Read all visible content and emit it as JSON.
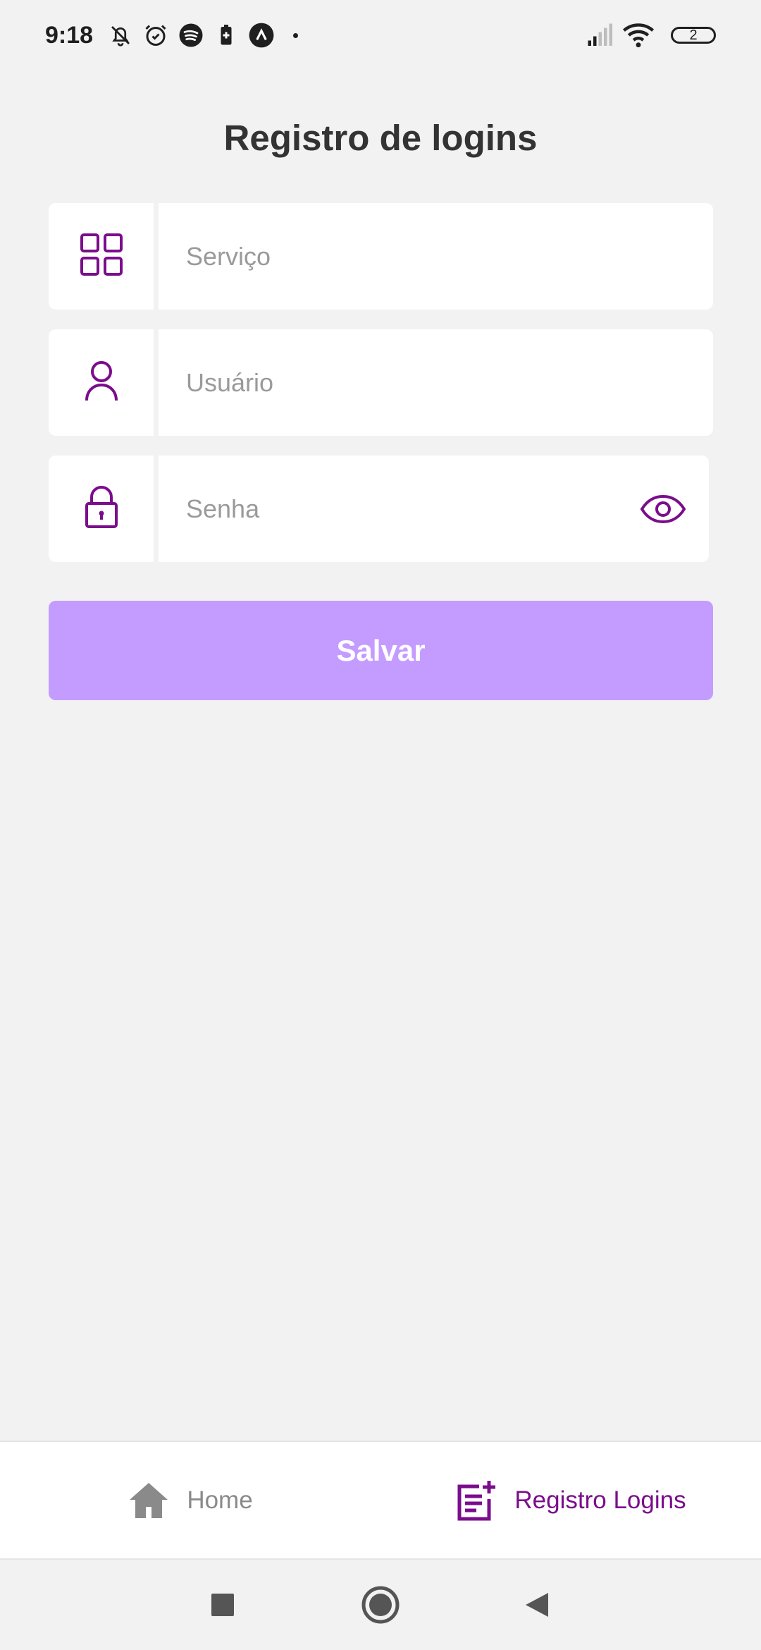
{
  "status_bar": {
    "time": "9:18",
    "battery_level": "2",
    "icons": [
      "muted-bell-icon",
      "alarm-icon",
      "spotify-icon",
      "battery-saver-icon",
      "app-notification-icon",
      "notification-dot",
      "signal-icon",
      "wifi-icon",
      "battery-icon"
    ]
  },
  "page": {
    "title": "Registro de logins"
  },
  "form": {
    "service": {
      "placeholder": "Serviço",
      "value": "",
      "icon": "grid-icon"
    },
    "user": {
      "placeholder": "Usuário",
      "value": "",
      "icon": "user-icon"
    },
    "password": {
      "placeholder": "Senha",
      "value": "",
      "icon": "lock-icon",
      "toggle_icon": "eye-icon"
    },
    "save_label": "Salvar"
  },
  "tab_bar": {
    "tabs": [
      {
        "label": "Home",
        "icon": "home-icon",
        "active": false
      },
      {
        "label": "Registro Logins",
        "icon": "add-note-icon",
        "active": true
      }
    ]
  },
  "colors": {
    "accent": "#7b0d8c",
    "button": "#c49cff",
    "background": "#f2f2f2",
    "inactive": "#8a8a8a"
  }
}
